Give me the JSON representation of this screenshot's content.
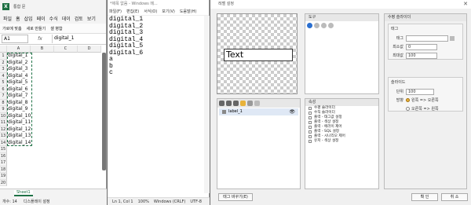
{
  "excel": {
    "title": "통합 문",
    "menu": [
      "파일",
      "홈",
      "삽입",
      "페이",
      "수식",
      "데이",
      "검토",
      "보기"
    ],
    "ribbon": [
      "가로에 맞춤",
      "새로 만들기",
      "셀 병합"
    ],
    "name_box": "A1",
    "fx": "fx",
    "formula_value": "digital_1",
    "columns": [
      "A",
      "B",
      "C",
      "D"
    ],
    "rows": [
      "1",
      "2",
      "3",
      "4",
      "5",
      "6",
      "7",
      "8",
      "9",
      "10",
      "11",
      "12",
      "13",
      "14",
      "15",
      "16",
      "17",
      "18",
      "19",
      "20"
    ],
    "cells": [
      "digital_1",
      "digital_2",
      "digital_3",
      "digital_4",
      "digital_5",
      "digital_6",
      "digital_7",
      "digital_8",
      "digital_9",
      "digital_10",
      "digital_11",
      "digital_12",
      "digital_13",
      "digital_14"
    ],
    "sheet_tab": "Sheet1",
    "status": "개수: 14",
    "status2": "디스플레이 설정"
  },
  "notepad": {
    "title": "*제목 없음 - Windows 메...",
    "menu": [
      "파일(F)",
      "편집(E)",
      "서식(O)",
      "보기(V)",
      "도움말(H)"
    ],
    "lines": [
      "digital_1",
      "digital_2",
      "digital_3",
      "digital_4",
      "digital_5",
      "digital_6",
      "a",
      "b",
      "c"
    ],
    "status": [
      "Ln 1, Col 1",
      "100%",
      "Windows (CRLF)",
      "UTF-8"
    ]
  },
  "dialog": {
    "title": "레벨 설정",
    "preview_text": "Text",
    "tool_panel_title": "도구",
    "layer_name": "label_1",
    "attr_title": "속성",
    "attributes": [
      "수평 슬라이더",
      "수직 슬라이더",
      "출력 - 태그값 설정",
      "출력 - 색상 설정",
      "출력 - 에러이 제어",
      "출력 - SQL 설정",
      "출력 - 시나리오 제어",
      "유저 - 색상 설정"
    ],
    "slider_panel_title": "수평 슬라이더",
    "tag_group_title": "태그",
    "tag_label": "태그",
    "min_label": "최소값",
    "min_value": "0",
    "max_label": "최대값",
    "max_value": "100",
    "slider_group_title": "슬라이드",
    "step_label": "단위",
    "step_value": "100",
    "dir_label": "방향",
    "dir_left": "왼쪽 => 오른쪽",
    "dir_right": "오른쪽 => 왼쪽",
    "tag_change_button": "태그 바꾸기(E)",
    "ok_button": "확 인",
    "cancel_button": "취 소"
  }
}
